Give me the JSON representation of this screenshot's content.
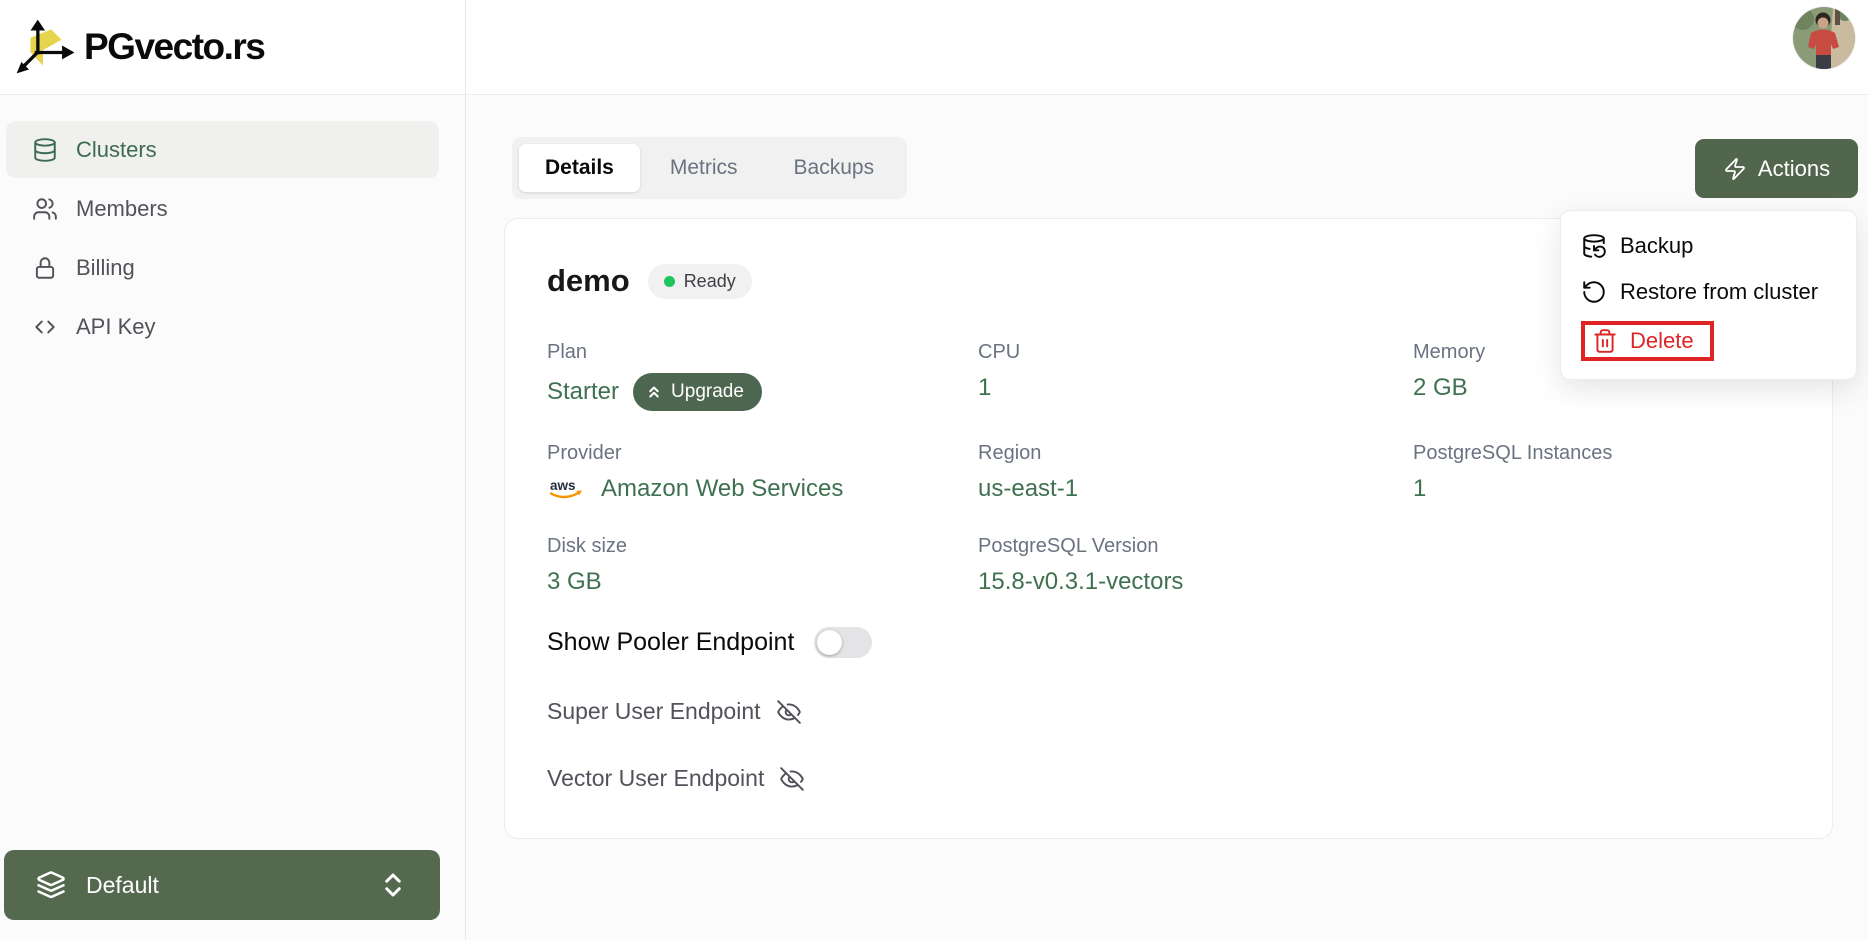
{
  "brand": {
    "name": "PGvecto.rs",
    "logo_icon": "vector-cube-axes"
  },
  "colors": {
    "accent_green_text": "#3F7150",
    "button_green": "#52664E",
    "sidebar_active_green": "#3D6B4F",
    "status_dot_green": "#1FC45F",
    "danger_red": "#DC2626",
    "highlight_border_red": "#E02424"
  },
  "sidebar": {
    "items": [
      {
        "label": "Clusters",
        "icon": "database-icon",
        "active": true
      },
      {
        "label": "Members",
        "icon": "users-icon",
        "active": false
      },
      {
        "label": "Billing",
        "icon": "lock-icon",
        "active": false
      },
      {
        "label": "API Key",
        "icon": "code-icon",
        "active": false
      }
    ],
    "org_switcher": {
      "label": "Default",
      "icon": "layers-icon",
      "chevron": "chevrons-up-down-icon"
    }
  },
  "tabs": [
    {
      "label": "Details",
      "active": true
    },
    {
      "label": "Metrics",
      "active": false
    },
    {
      "label": "Backups",
      "active": false
    }
  ],
  "actions": {
    "button_label": "Actions",
    "button_icon": "zap-icon",
    "menu": [
      {
        "label": "Backup",
        "icon": "database-backup-icon",
        "danger": false,
        "highlighted": false
      },
      {
        "label": "Restore from cluster",
        "icon": "rotate-ccw-icon",
        "danger": false,
        "highlighted": false
      },
      {
        "label": "Delete",
        "icon": "trash-icon",
        "danger": true,
        "highlighted": true
      }
    ]
  },
  "cluster": {
    "name": "demo",
    "status": "Ready",
    "fields": [
      {
        "label": "Plan",
        "value": "Starter",
        "action": "Upgrade"
      },
      {
        "label": "CPU",
        "value": "1"
      },
      {
        "label": "Memory",
        "value": "2 GB"
      },
      {
        "label": "Provider",
        "value": "Amazon Web Services",
        "icon": "aws-logo"
      },
      {
        "label": "Region",
        "value": "us-east-1"
      },
      {
        "label": "PostgreSQL Instances",
        "value": "1"
      },
      {
        "label": "Disk size",
        "value": "3 GB"
      },
      {
        "label": "PostgreSQL Version",
        "value": "15.8-v0.3.1-vectors"
      }
    ],
    "pooler_toggle": {
      "label": "Show Pooler Endpoint",
      "enabled": false
    },
    "endpoints": [
      {
        "label": "Super User Endpoint",
        "icon": "eye-off-icon",
        "hidden": true
      },
      {
        "label": "Vector User Endpoint",
        "icon": "eye-off-icon",
        "hidden": true
      }
    ]
  }
}
